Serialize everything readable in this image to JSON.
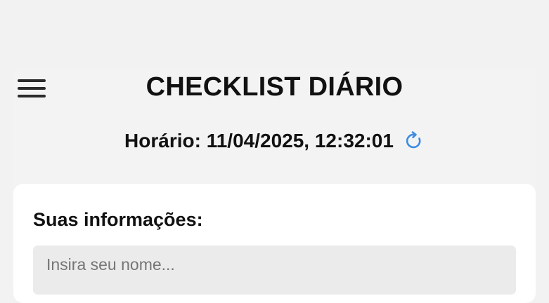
{
  "header": {
    "title": "CHECKLIST DIÁRIO",
    "time_label": "Horário: 11/04/2025, 12:32:01",
    "menu_icon": "hamburger-menu-icon",
    "refresh_icon": "refresh-icon",
    "accent_color": "#3d8be0"
  },
  "info": {
    "section_title": "Suas informações:",
    "name_placeholder": "Insira seu nome...",
    "name_value": ""
  }
}
